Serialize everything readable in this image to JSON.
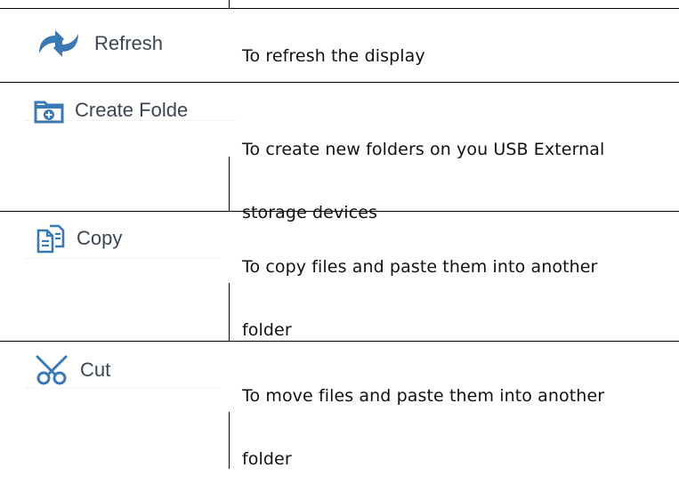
{
  "rows": [
    {
      "icon": "refresh-icon",
      "label": "Refresh",
      "desc_lines": [
        "To refresh the display"
      ]
    },
    {
      "icon": "create-folder-icon",
      "label": "Create Folde",
      "desc_lines": [
        "To create new folders on you USB External",
        "storage devices"
      ]
    },
    {
      "icon": "copy-icon",
      "label": "Copy",
      "desc_lines": [
        "To copy files and paste them into another",
        "folder"
      ]
    },
    {
      "icon": "cut-icon",
      "label": "Cut",
      "desc_lines": [
        "To move files and paste them into another",
        "folder"
      ]
    }
  ],
  "colors": {
    "icon": "#3b78b6",
    "label": "#3b4654",
    "text": "#111111",
    "rule": "#000000"
  }
}
